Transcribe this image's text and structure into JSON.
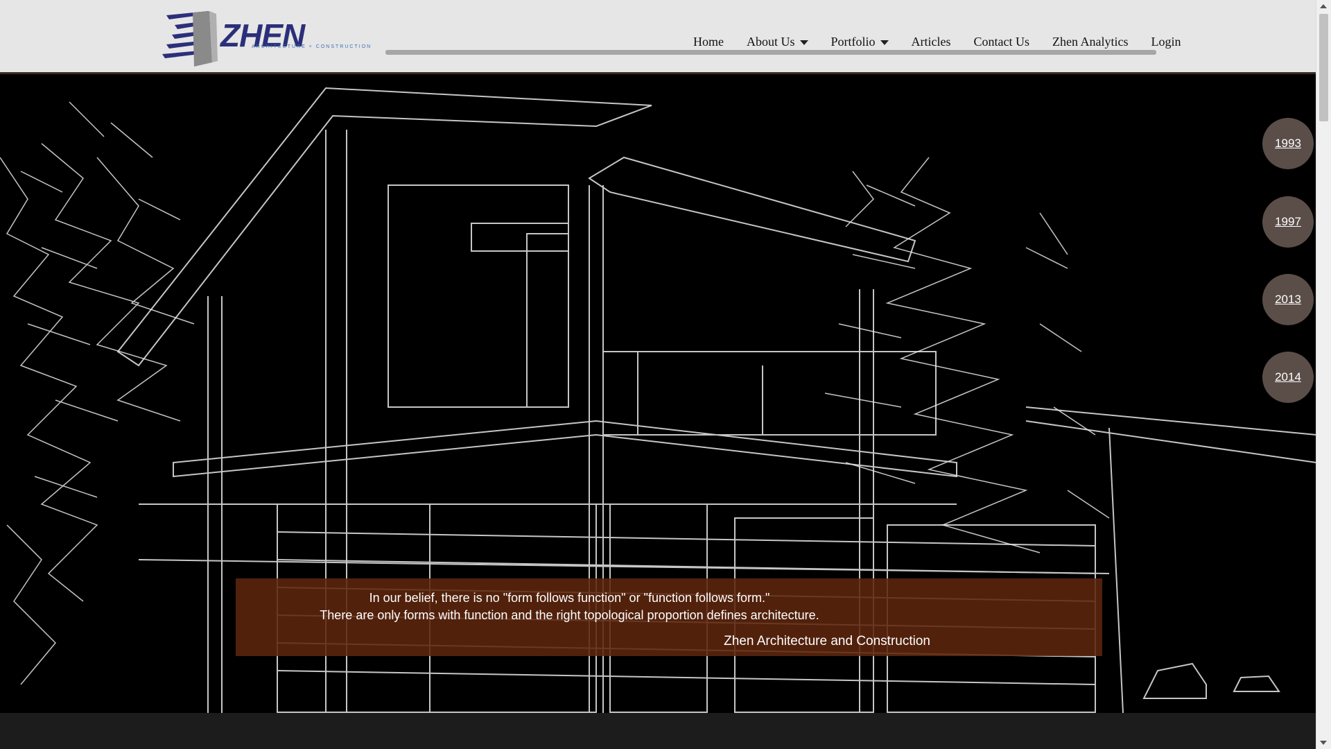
{
  "header": {
    "logo_text": "ZHEN",
    "logo_subtext": "ARCHITECTURE + CONSTRUCTION"
  },
  "nav": {
    "items": [
      {
        "label": "Home",
        "has_dropdown": false
      },
      {
        "label": "About Us",
        "has_dropdown": true
      },
      {
        "label": "Portfolio",
        "has_dropdown": true
      },
      {
        "label": "Articles",
        "has_dropdown": false
      },
      {
        "label": "Contact Us",
        "has_dropdown": false
      },
      {
        "label": "Zhen Analytics",
        "has_dropdown": false
      },
      {
        "label": "Login",
        "has_dropdown": false
      }
    ]
  },
  "timeline": {
    "years": [
      "1993",
      "1997",
      "2013",
      "2014"
    ]
  },
  "quote": {
    "line1": "In our belief, there is no \"form follows function\" or \"function follows form.\"",
    "line2": "There are only forms with function and the right topological proportion defines architecture.",
    "attribution": "Zhen Architecture and Construction"
  },
  "colors": {
    "header_bg": "#e6e6e6",
    "hero_bg": "#000000",
    "year_circle": "#5b4e48",
    "quote_bg": "#5c260e",
    "logo_blue": "#2b2f7a"
  }
}
